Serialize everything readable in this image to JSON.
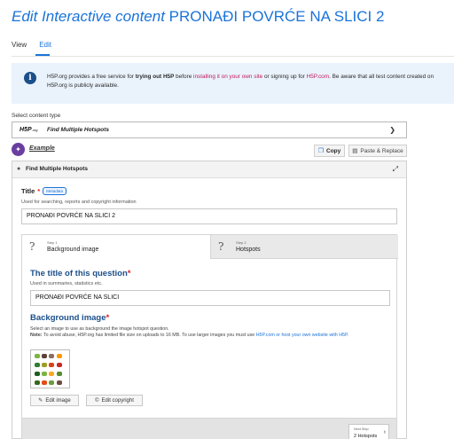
{
  "page": {
    "title_prefix": "Edit Interactive content",
    "title_name": "PRONAĐI POVRĆE NA SLICI 2"
  },
  "tabs": {
    "view": "View",
    "edit": "Edit"
  },
  "info": {
    "part1": "H5P.org provides a free service for ",
    "part2": "trying out H5P",
    "part3": " before ",
    "part4": "installing it on your own site",
    "part5": " or signing up for ",
    "part6": "H5P.com",
    "part7": ". Be aware that all test content created on H5P.org is publicly available."
  },
  "content_type": {
    "label": "Select content type",
    "logo": "H5P",
    "logo_sub": ".org",
    "selected": "Find Multiple Hotspots"
  },
  "example": {
    "label": "Example",
    "copy": "Copy",
    "paste": "Paste & Replace"
  },
  "editor": {
    "header": "Find Multiple Hotspots",
    "title_label": "Title",
    "metadata": "Metadata",
    "title_desc": "Used for searching, reports and copyright information",
    "title_value": "PRONAĐI POVRĆE NA SLICI 2"
  },
  "steps": {
    "step1_no": "Step 1",
    "step1_name": "Background image",
    "step2_no": "Step 2",
    "step2_name": "Hotspots"
  },
  "question": {
    "label": "The title of this question",
    "desc": "Used in summaries, statistics etc.",
    "value": "PRONAĐI POVRĆE NA SLICI"
  },
  "background": {
    "label": "Background image",
    "desc1": "Select an image to use as background the image hotspot question.",
    "note_label": "Note:",
    "desc2": " To avoid abuse, H5P.org has limited file size on uploads to 16 MB. To use larger images you must use ",
    "desc2_link": "H5P.com or host your own website with H5P",
    "desc2_end": ".",
    "edit_image": "Edit image",
    "edit_copyright": "Edit copyright"
  },
  "nav": {
    "next_label": "Next Step",
    "next_value": "2 Hotspots"
  },
  "colors": {
    "accent": "#1a73d9",
    "heading": "#1b4f8a",
    "pink": "#c2185b"
  }
}
